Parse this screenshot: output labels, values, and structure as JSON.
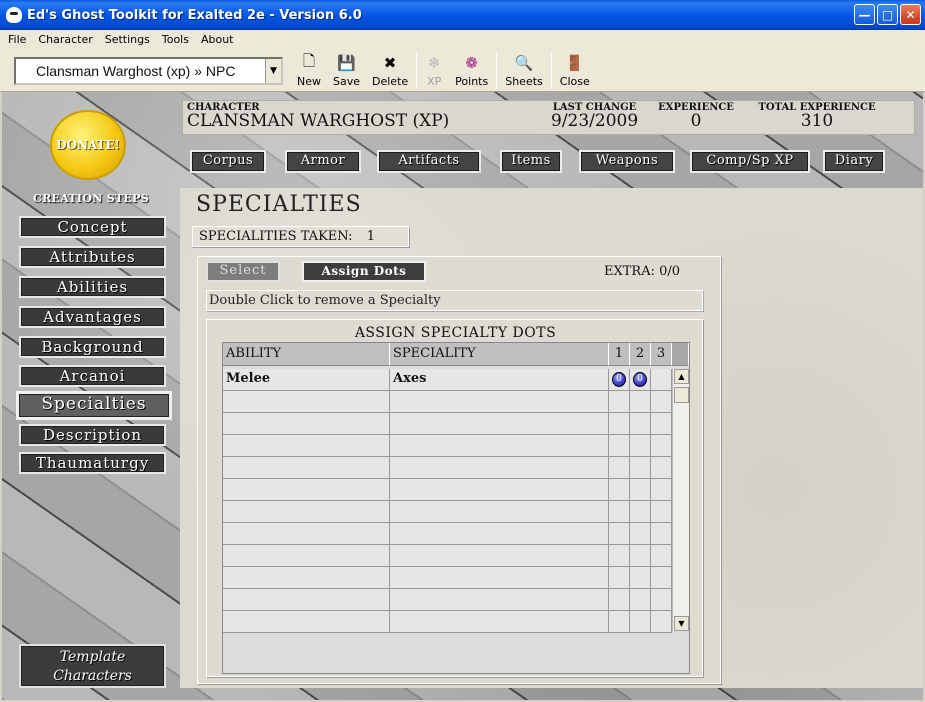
{
  "window": {
    "title": "Ed's Ghost Toolkit for Exalted 2e - Version 6.0"
  },
  "menu": [
    "File",
    "Character",
    "Settings",
    "Tools",
    "About"
  ],
  "toolbar": {
    "character_select": "Clansman Warghost (xp) » NPC",
    "buttons": [
      {
        "label": "New",
        "icon": "new-document-icon",
        "enabled": true
      },
      {
        "label": "Save",
        "icon": "save-disk-icon",
        "enabled": true
      },
      {
        "label": "Delete",
        "icon": "delete-x-icon",
        "enabled": true
      },
      {
        "label": "XP",
        "icon": "xp-icon",
        "enabled": false
      },
      {
        "label": "Points",
        "icon": "points-icon",
        "enabled": true
      },
      {
        "label": "Sheets",
        "icon": "sheets-icon",
        "enabled": true
      },
      {
        "label": "Close",
        "icon": "close-door-icon",
        "enabled": true
      }
    ]
  },
  "sidebar": {
    "donate_label": "DONATE!",
    "steps_title": "CREATION STEPS",
    "steps": [
      "Concept",
      "Attributes",
      "Abilities",
      "Advantages",
      "Background",
      "Arcanoi",
      "Specialties",
      "Description",
      "Thaumaturgy"
    ],
    "active_step": "Specialties",
    "template_line1": "Template",
    "template_line2": "Characters"
  },
  "header": {
    "character_label": "CHARACTER",
    "character_value": "CLANSMAN WARGHOST (XP)",
    "last_change_label": "LAST CHANGE",
    "last_change_value": "9/23/2009",
    "experience_label": "EXPERIENCE",
    "experience_value": "0",
    "total_label": "TOTAL EXPERIENCE",
    "total_value": "310"
  },
  "tabs": [
    "Corpus",
    "Armor",
    "Artifacts",
    "Items",
    "Weapons",
    "Comp/Sp XP",
    "Diary"
  ],
  "content": {
    "title": "SPECIALTIES",
    "taken_label": "SPECIALITIES TAKEN:",
    "taken_value": "1",
    "select_label": "Select",
    "assign_label": "Assign Dots",
    "extra_label": "EXTRA:",
    "extra_value": "0/0",
    "hint": "Double Click to remove a Specialty",
    "grid_title": "ASSIGN SPECIALTY DOTS",
    "columns": [
      "ABILITY",
      "SPECIALITY",
      "1",
      "2",
      "3"
    ],
    "rows": [
      {
        "ability": "Melee",
        "speciality": "Axes",
        "dots": [
          true,
          true,
          false
        ]
      }
    ],
    "dot_glyph": "0",
    "empty_rows": 11
  },
  "colors": {
    "titlebar": "#0556e5",
    "dot": "#3a3ac8"
  }
}
